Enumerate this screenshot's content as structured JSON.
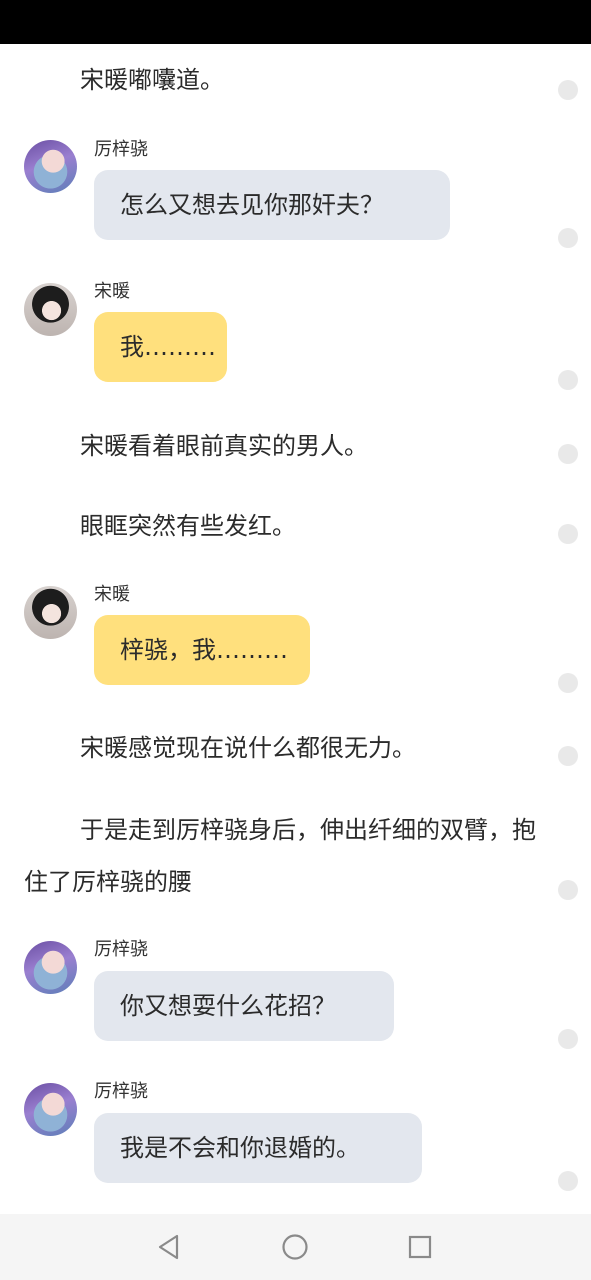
{
  "story": {
    "narration_1": "宋暖嘟囔道。",
    "narration_2": "宋暖看着眼前真实的男人。",
    "narration_3": "眼眶突然有些发红。",
    "narration_4": "宋暖感觉现在说什么都很无力。",
    "narration_5": "于是走到厉梓骁身后，伸出纤细的双臂，抱住了厉梓骁的腰"
  },
  "messages": [
    {
      "speaker": "厉梓骁",
      "text": "怎么又想去见你那奸夫？"
    },
    {
      "speaker": "宋暖",
      "text": "我………"
    },
    {
      "speaker": "宋暖",
      "text": "梓骁，我………"
    },
    {
      "speaker": "厉梓骁",
      "text": "你又想耍什么花招？"
    },
    {
      "speaker": "厉梓骁",
      "text": "我是不会和你退婚的。"
    }
  ],
  "colors": {
    "male_bubble": "#e3e7ee",
    "female_bubble": "#ffe07d",
    "status_bar": "#000000",
    "nav_bar": "#f5f5f5"
  },
  "icons": {
    "nav_back": "triangle-back-icon",
    "nav_home": "circle-home-icon",
    "nav_recents": "square-recents-icon"
  }
}
